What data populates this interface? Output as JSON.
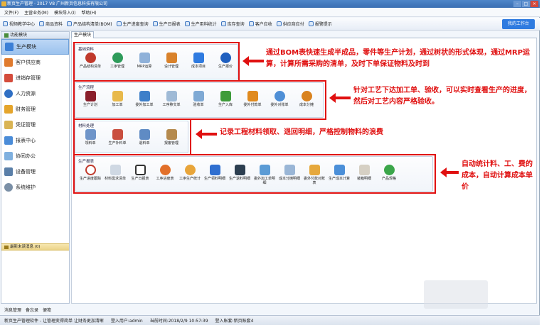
{
  "window": {
    "title": "新页生产管理 - 2017 V8 广州新页信息科技有限公司"
  },
  "menu": [
    "文件(F)",
    "主营业务(M)",
    "模块导入(I)",
    "帮助(H)"
  ],
  "toolbar": {
    "items": [
      "视频教学中心",
      "商品资料",
      "产品结构清单(BOM)",
      "生产进度查询",
      "生产日报表",
      "生产用料统计",
      "库存查询",
      "客户应收",
      "供应商应付",
      "报警提示"
    ],
    "workbench": "我的工作台"
  },
  "left": {
    "header": "功能模块",
    "items": [
      "生产模块",
      "客户供应商",
      "进销存管理",
      "人力资源",
      "财务管理",
      "凭证管理",
      "报表中心",
      "协同办公",
      "设备管理",
      "系统维护"
    ],
    "message": "最新未读消息 (0)",
    "bottom_links": [
      "消息管理",
      "备忘录",
      "便笺"
    ]
  },
  "tab": "生产模块",
  "groups": [
    {
      "title": "基础资料",
      "items": [
        "产品结构清单",
        "工序管理",
        "MRP运算",
        "设计管理",
        "成本项目",
        "生产报价"
      ],
      "annotation": "通过BOM表快速生成半成品，零件等生产计划，通过树状的形式体现，通过MRP运算，计算所需采购的清单，及时下单保证物料及时到"
    },
    {
      "title": "生产流程",
      "items": [
        "生产计划",
        "加工单",
        "委外加工单",
        "工序移交单",
        "验收单",
        "生产入库",
        "委外付款单",
        "委外对账单",
        "成本分摊"
      ],
      "annotation": "针对工艺下达加工单、验收，可以实时查看生产的进度，然后对工艺内容严格验收。"
    },
    {
      "title": "材料处理",
      "items": [
        "领料单",
        "生产补料单",
        "退料单",
        "报废管理"
      ],
      "annotation": "记录工程材料领取、退回明细，严格控制物料的浪费"
    },
    {
      "title": "生产报表",
      "items": [
        "生产进度跟踪",
        "材料需求清单",
        "生产日报表",
        "工序进度表",
        "工序生产统计",
        "生产领料明细",
        "生产退料明细",
        "委外加工单明细",
        "成本分摊明细",
        "委外付款对账表",
        "生产成本计算",
        "装箱明细",
        "产品规格"
      ],
      "annotation": "自动统计料、工、费的成本，自动计算成本单价"
    }
  ],
  "status": {
    "company": "新页生产管理软件 - 让管理变得简单 让财务更加清晰",
    "user": "登入用户:admin",
    "time": "当前时间:2018/2/9 10:57:39",
    "account": "登入账套:新页账套4"
  },
  "colors": {
    "accent": "#2f7be0",
    "annotation": "#e01010"
  }
}
